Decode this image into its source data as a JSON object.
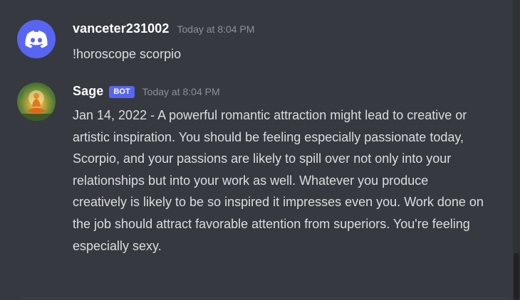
{
  "messages": [
    {
      "username": "vanceter231002",
      "timestamp": "Today at 8:04 PM",
      "content": "!horoscope scorpio",
      "avatar_icon": "discord-logo-icon",
      "avatar_color": "#5865f2"
    },
    {
      "username": "Sage",
      "bot_tag": "BOT",
      "timestamp": "Today at 8:04 PM",
      "content": "Jan 14, 2022 - A powerful romantic attraction might lead to creative or artistic inspiration. You should be feeling especially passionate today, Scorpio, and your passions are likely to spill over not only into your relationships but into your work as well. Whatever you produce creatively is likely to be so inspired it impresses even you. Work done on the job should attract favorable attention from superiors. You're feeling especially sexy.",
      "avatar_icon": "meditating-figure-icon",
      "bot_tag_color": "#5865f2"
    }
  ],
  "theme": {
    "background": "#36393f",
    "username_color": "#ffffff",
    "text_color": "#dcddde",
    "timestamp_color": "#8e9297"
  }
}
